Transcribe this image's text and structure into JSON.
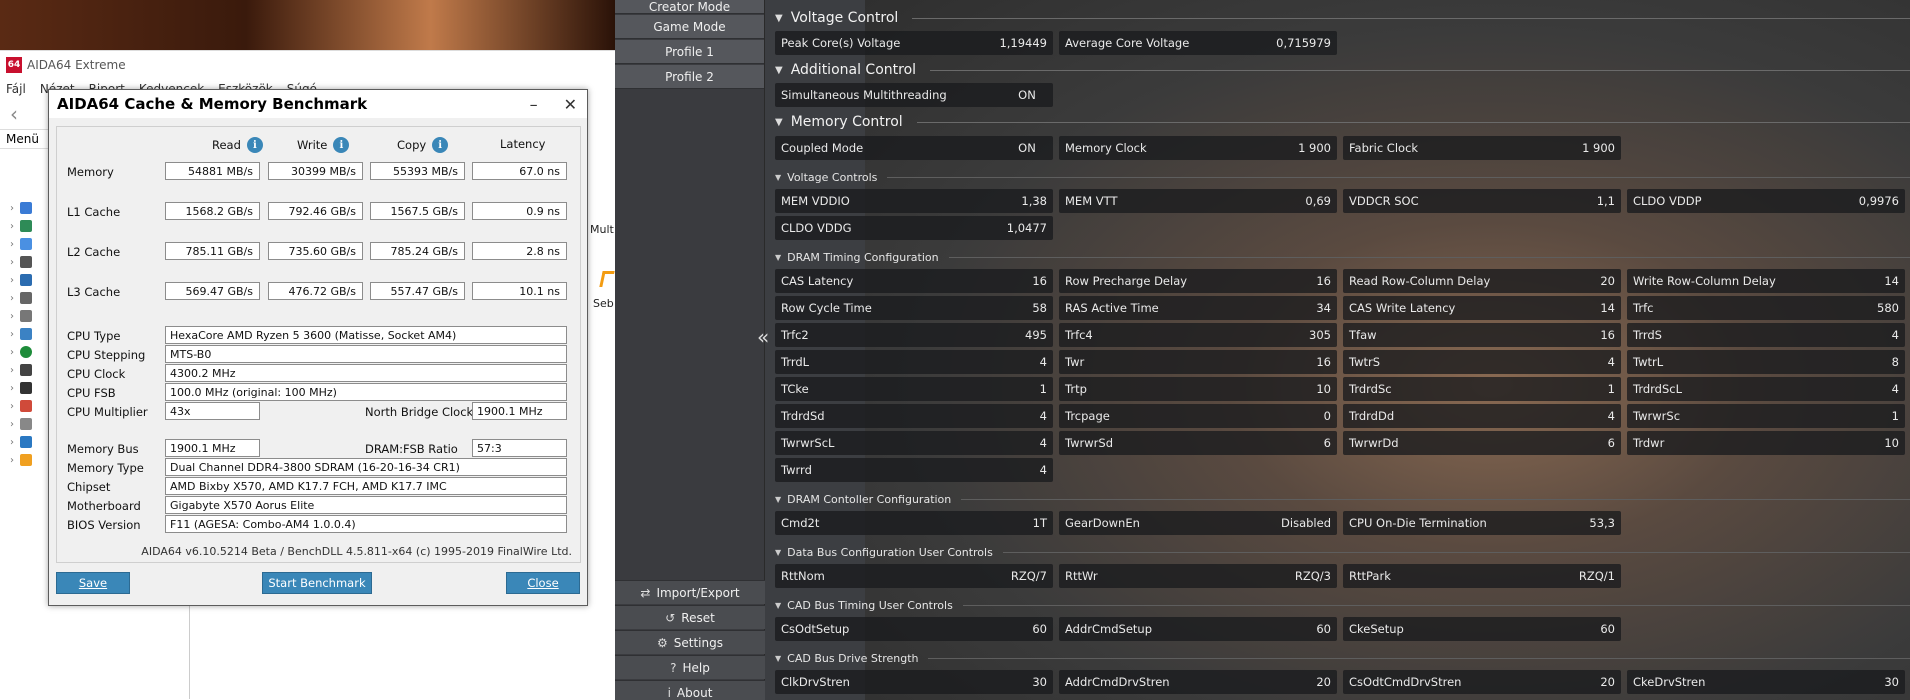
{
  "aida_main": {
    "title": "AIDA64 Extreme",
    "logo": "64",
    "menu": [
      "Fájl",
      "Nézet",
      "Riport",
      "Kedvencek",
      "Eszközök",
      "Súgó"
    ],
    "tree_label": "Menü",
    "right_partial": {
      "mult": "Mult",
      "seb": "Seb"
    }
  },
  "bench": {
    "title": "AIDA64 Cache & Memory Benchmark",
    "headers": {
      "read": "Read",
      "write": "Write",
      "copy": "Copy",
      "latency": "Latency"
    },
    "rows": [
      {
        "label": "Memory",
        "read": "54881 MB/s",
        "write": "30399 MB/s",
        "copy": "55393 MB/s",
        "latency": "67.0 ns"
      },
      {
        "label": "L1 Cache",
        "read": "1568.2 GB/s",
        "write": "792.46 GB/s",
        "copy": "1567.5 GB/s",
        "latency": "0.9 ns"
      },
      {
        "label": "L2 Cache",
        "read": "785.11 GB/s",
        "write": "735.60 GB/s",
        "copy": "785.24 GB/s",
        "latency": "2.8 ns"
      },
      {
        "label": "L3 Cache",
        "read": "569.47 GB/s",
        "write": "476.72 GB/s",
        "copy": "557.47 GB/s",
        "latency": "10.1 ns"
      }
    ],
    "info": {
      "cpu_type_label": "CPU Type",
      "cpu_type": "HexaCore AMD Ryzen 5 3600  (Matisse, Socket AM4)",
      "cpu_stepping_label": "CPU Stepping",
      "cpu_stepping": "MTS-B0",
      "cpu_clock_label": "CPU Clock",
      "cpu_clock": "4300.2 MHz",
      "cpu_fsb_label": "CPU FSB",
      "cpu_fsb": "100.0 MHz  (original: 100 MHz)",
      "cpu_mult_label": "CPU Multiplier",
      "cpu_mult": "43x",
      "nb_clock_label": "North Bridge Clock",
      "nb_clock": "1900.1 MHz",
      "mem_bus_label": "Memory Bus",
      "mem_bus": "1900.1 MHz",
      "dram_ratio_label": "DRAM:FSB Ratio",
      "dram_ratio": "57:3",
      "mem_type_label": "Memory Type",
      "mem_type": "Dual Channel DDR4-3800 SDRAM  (16-20-16-34 CR1)",
      "chipset_label": "Chipset",
      "chipset": "AMD Bixby X570, AMD K17.7 FCH, AMD K17.7 IMC",
      "mobo_label": "Motherboard",
      "mobo": "Gigabyte X570 Aorus Elite",
      "bios_label": "BIOS Version",
      "bios": "F11  (AGESA: Combo-AM4 1.0.0.4)"
    },
    "footnote": "AIDA64 v6.10.5214 Beta / BenchDLL 4.5.811-x64  (c) 1995-2019 FinalWire Ltd.",
    "buttons": {
      "save": "Save",
      "start": "Start Benchmark",
      "close": "Close"
    }
  },
  "rm": {
    "profiles": [
      "Creator Mode",
      "Game Mode",
      "Profile 1",
      "Profile 2"
    ],
    "bottom_buttons": [
      {
        "label": "Import/Export",
        "icon": "import-export-icon"
      },
      {
        "label": "Reset",
        "icon": "reset-icon"
      },
      {
        "label": "Settings",
        "icon": "gear-icon"
      },
      {
        "label": "Help",
        "icon": "help-icon"
      },
      {
        "label": "About",
        "icon": "info-icon"
      }
    ],
    "sections": {
      "voltage_control": "Voltage Control",
      "additional_control": "Additional Control",
      "memory_control": "Memory Control",
      "voltage_controls": "Voltage Controls",
      "dram_timing": "DRAM Timing Configuration",
      "dram_controller": "DRAM Contoller Configuration",
      "data_bus": "Data Bus Configuration User Controls",
      "cad_timing": "CAD Bus Timing User Controls",
      "cad_drive": "CAD Bus Drive Strength"
    },
    "voltage": [
      {
        "label": "Peak Core(s) Voltage",
        "value": "1,19449"
      },
      {
        "label": "Average Core Voltage",
        "value": "0,715979"
      }
    ],
    "additional": [
      {
        "label": "Simultaneous Multithreading",
        "value": "ON"
      }
    ],
    "memory": [
      {
        "label": "Coupled Mode",
        "value": "ON"
      },
      {
        "label": "Memory Clock",
        "value": "1 900"
      },
      {
        "label": "Fabric Clock",
        "value": "1 900"
      }
    ],
    "vctrl": [
      {
        "label": "MEM VDDIO",
        "value": "1,38"
      },
      {
        "label": "MEM VTT",
        "value": "0,69"
      },
      {
        "label": "VDDCR SOC",
        "value": "1,1"
      },
      {
        "label": "CLDO VDDP",
        "value": "0,9976"
      },
      {
        "label": "CLDO VDDG",
        "value": "1,0477"
      }
    ],
    "timing": [
      {
        "label": "CAS Latency",
        "value": "16"
      },
      {
        "label": "Row Precharge Delay",
        "value": "16"
      },
      {
        "label": "Read Row-Column Delay",
        "value": "20"
      },
      {
        "label": "Write Row-Column Delay",
        "value": "14"
      },
      {
        "label": "Row Cycle Time",
        "value": "58"
      },
      {
        "label": "RAS Active Time",
        "value": "34"
      },
      {
        "label": "CAS Write Latency",
        "value": "14"
      },
      {
        "label": "Trfc",
        "value": "580"
      },
      {
        "label": "Trfc2",
        "value": "495"
      },
      {
        "label": "Trfc4",
        "value": "305"
      },
      {
        "label": "Tfaw",
        "value": "16"
      },
      {
        "label": "TrrdS",
        "value": "4"
      },
      {
        "label": "TrrdL",
        "value": "4"
      },
      {
        "label": "Twr",
        "value": "16"
      },
      {
        "label": "TwtrS",
        "value": "4"
      },
      {
        "label": "TwtrL",
        "value": "8"
      },
      {
        "label": "TCke",
        "value": "1"
      },
      {
        "label": "Trtp",
        "value": "10"
      },
      {
        "label": "TrdrdSc",
        "value": "1"
      },
      {
        "label": "TrdrdScL",
        "value": "4"
      },
      {
        "label": "TrdrdSd",
        "value": "4"
      },
      {
        "label": "Trcpage",
        "value": "0"
      },
      {
        "label": "TrdrdDd",
        "value": "4"
      },
      {
        "label": "TwrwrSc",
        "value": "1"
      },
      {
        "label": "TwrwrScL",
        "value": "4"
      },
      {
        "label": "TwrwrSd",
        "value": "6"
      },
      {
        "label": "TwrwrDd",
        "value": "6"
      },
      {
        "label": "Trdwr",
        "value": "10"
      },
      {
        "label": "Twrrd",
        "value": "4"
      }
    ],
    "controller": [
      {
        "label": "Cmd2t",
        "value": "1T"
      },
      {
        "label": "GearDownEn",
        "value": "Disabled"
      },
      {
        "label": "CPU On-Die Termination",
        "value": "53,3"
      }
    ],
    "databus": [
      {
        "label": "RttNom",
        "value": "RZQ/7"
      },
      {
        "label": "RttWr",
        "value": "RZQ/3"
      },
      {
        "label": "RttPark",
        "value": "RZQ/1"
      }
    ],
    "cadtiming": [
      {
        "label": "CsOdtSetup",
        "value": "60"
      },
      {
        "label": "AddrCmdSetup",
        "value": "60"
      },
      {
        "label": "CkeSetup",
        "value": "60"
      }
    ],
    "caddrive": [
      {
        "label": "ClkDrvStren",
        "value": "30"
      },
      {
        "label": "AddrCmdDrvStren",
        "value": "20"
      },
      {
        "label": "CsOdtCmdDrvStren",
        "value": "20"
      },
      {
        "label": "CkeDrvStren",
        "value": "30"
      }
    ]
  }
}
